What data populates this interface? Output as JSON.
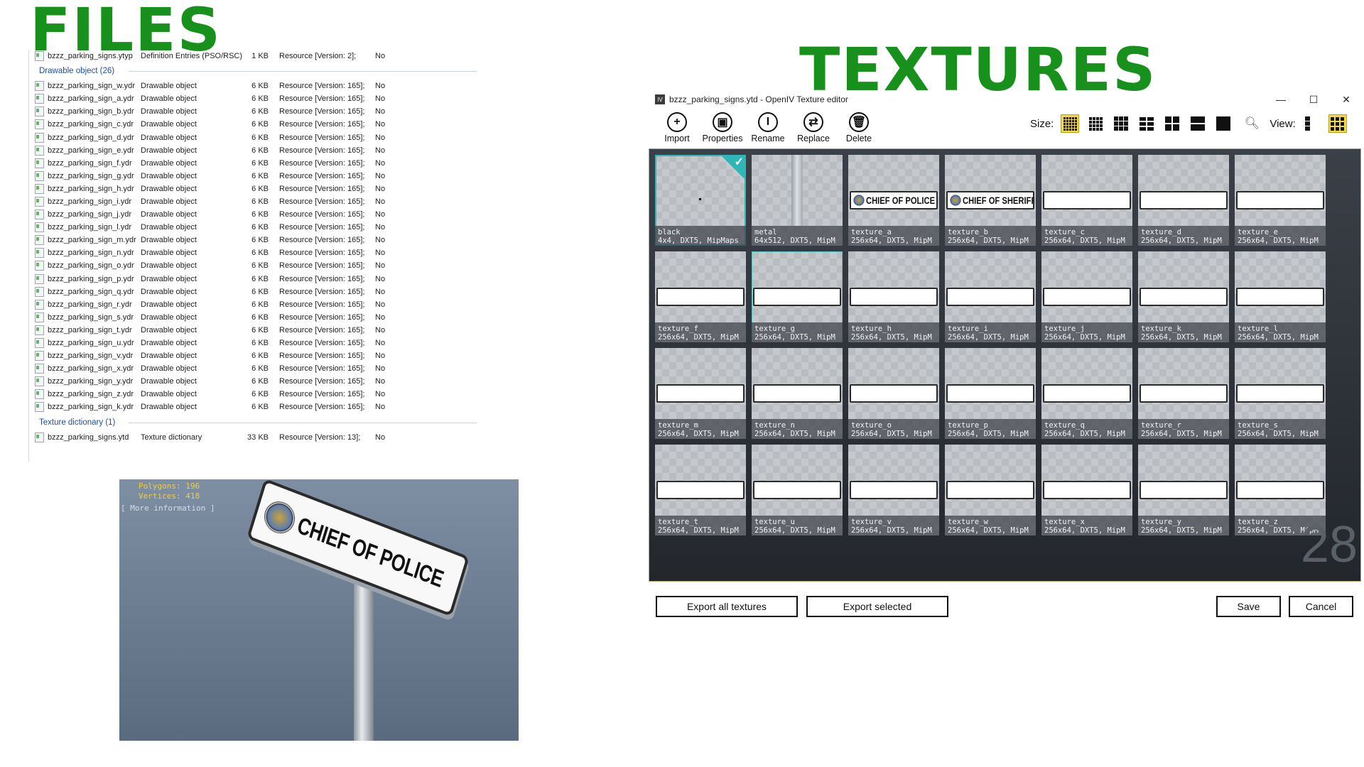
{
  "headings": {
    "files": "FILES",
    "textures": "TEXTURES"
  },
  "file_list": {
    "top_row": {
      "name": "bzzz_parking_signs.ytyp",
      "type": "Definition Entries (PSO/RSC)",
      "size": "1 KB",
      "version": "Resource [Version: 2];",
      "flag": "No"
    },
    "groups": [
      {
        "label": "Drawable object (26)",
        "rows": [
          {
            "name": "bzzz_parking_sign_w.ydr",
            "type": "Drawable object",
            "size": "6 KB",
            "version": "Resource [Version: 165];",
            "flag": "No"
          },
          {
            "name": "bzzz_parking_sign_a.ydr",
            "type": "Drawable object",
            "size": "6 KB",
            "version": "Resource [Version: 165];",
            "flag": "No"
          },
          {
            "name": "bzzz_parking_sign_b.ydr",
            "type": "Drawable object",
            "size": "6 KB",
            "version": "Resource [Version: 165];",
            "flag": "No"
          },
          {
            "name": "bzzz_parking_sign_c.ydr",
            "type": "Drawable object",
            "size": "6 KB",
            "version": "Resource [Version: 165];",
            "flag": "No"
          },
          {
            "name": "bzzz_parking_sign_d.ydr",
            "type": "Drawable object",
            "size": "6 KB",
            "version": "Resource [Version: 165];",
            "flag": "No"
          },
          {
            "name": "bzzz_parking_sign_e.ydr",
            "type": "Drawable object",
            "size": "6 KB",
            "version": "Resource [Version: 165];",
            "flag": "No"
          },
          {
            "name": "bzzz_parking_sign_f.ydr",
            "type": "Drawable object",
            "size": "6 KB",
            "version": "Resource [Version: 165];",
            "flag": "No"
          },
          {
            "name": "bzzz_parking_sign_g.ydr",
            "type": "Drawable object",
            "size": "6 KB",
            "version": "Resource [Version: 165];",
            "flag": "No"
          },
          {
            "name": "bzzz_parking_sign_h.ydr",
            "type": "Drawable object",
            "size": "6 KB",
            "version": "Resource [Version: 165];",
            "flag": "No"
          },
          {
            "name": "bzzz_parking_sign_i.ydr",
            "type": "Drawable object",
            "size": "6 KB",
            "version": "Resource [Version: 165];",
            "flag": "No"
          },
          {
            "name": "bzzz_parking_sign_j.ydr",
            "type": "Drawable object",
            "size": "6 KB",
            "version": "Resource [Version: 165];",
            "flag": "No"
          },
          {
            "name": "bzzz_parking_sign_l.ydr",
            "type": "Drawable object",
            "size": "6 KB",
            "version": "Resource [Version: 165];",
            "flag": "No"
          },
          {
            "name": "bzzz_parking_sign_m.ydr",
            "type": "Drawable object",
            "size": "6 KB",
            "version": "Resource [Version: 165];",
            "flag": "No"
          },
          {
            "name": "bzzz_parking_sign_n.ydr",
            "type": "Drawable object",
            "size": "6 KB",
            "version": "Resource [Version: 165];",
            "flag": "No"
          },
          {
            "name": "bzzz_parking_sign_o.ydr",
            "type": "Drawable object",
            "size": "6 KB",
            "version": "Resource [Version: 165];",
            "flag": "No"
          },
          {
            "name": "bzzz_parking_sign_p.ydr",
            "type": "Drawable object",
            "size": "6 KB",
            "version": "Resource [Version: 165];",
            "flag": "No"
          },
          {
            "name": "bzzz_parking_sign_q.ydr",
            "type": "Drawable object",
            "size": "6 KB",
            "version": "Resource [Version: 165];",
            "flag": "No"
          },
          {
            "name": "bzzz_parking_sign_r.ydr",
            "type": "Drawable object",
            "size": "6 KB",
            "version": "Resource [Version: 165];",
            "flag": "No"
          },
          {
            "name": "bzzz_parking_sign_s.ydr",
            "type": "Drawable object",
            "size": "6 KB",
            "version": "Resource [Version: 165];",
            "flag": "No"
          },
          {
            "name": "bzzz_parking_sign_t.ydr",
            "type": "Drawable object",
            "size": "6 KB",
            "version": "Resource [Version: 165];",
            "flag": "No"
          },
          {
            "name": "bzzz_parking_sign_u.ydr",
            "type": "Drawable object",
            "size": "6 KB",
            "version": "Resource [Version: 165];",
            "flag": "No"
          },
          {
            "name": "bzzz_parking_sign_v.ydr",
            "type": "Drawable object",
            "size": "6 KB",
            "version": "Resource [Version: 165];",
            "flag": "No"
          },
          {
            "name": "bzzz_parking_sign_x.ydr",
            "type": "Drawable object",
            "size": "6 KB",
            "version": "Resource [Version: 165];",
            "flag": "No"
          },
          {
            "name": "bzzz_parking_sign_y.ydr",
            "type": "Drawable object",
            "size": "6 KB",
            "version": "Resource [Version: 165];",
            "flag": "No"
          },
          {
            "name": "bzzz_parking_sign_z.ydr",
            "type": "Drawable object",
            "size": "6 KB",
            "version": "Resource [Version: 165];",
            "flag": "No"
          },
          {
            "name": "bzzz_parking_sign_k.ydr",
            "type": "Drawable object",
            "size": "6 KB",
            "version": "Resource [Version: 165];",
            "flag": "No"
          }
        ]
      },
      {
        "label": "Texture dictionary (1)",
        "rows": [
          {
            "name": "bzzz_parking_signs.ytd",
            "type": "Texture dictionary",
            "size": "33 KB",
            "version": "Resource [Version: 13];",
            "flag": "No"
          }
        ]
      }
    ]
  },
  "viewport": {
    "polygons": "Polygons: 196",
    "vertices": "Vertices: 418",
    "more_info": "[ More information ]",
    "sign_text": "CHIEF OF POLICE"
  },
  "texture_editor": {
    "title": "bzzz_parking_signs.ytd - OpenIV Texture editor",
    "app_icon": "IV",
    "window_buttons": {
      "minimize": "—",
      "maximize": "☐",
      "close": "✕"
    },
    "tools": [
      {
        "label": "Import",
        "glyph": "+",
        "icon": "import-icon"
      },
      {
        "label": "Properties",
        "glyph": "▣",
        "icon": "properties-icon"
      },
      {
        "label": "Rename",
        "glyph": "I",
        "icon": "rename-icon"
      },
      {
        "label": "Replace",
        "glyph": "⇄",
        "icon": "replace-icon"
      },
      {
        "label": "Delete",
        "glyph": "🗑",
        "icon": "delete-icon"
      }
    ],
    "size_label": "Size:",
    "view_label": "View:",
    "texture_count": "28",
    "textures": [
      {
        "name": "black",
        "info": "4x4, DXT5, MipMaps",
        "kind": "dot",
        "state": "selected"
      },
      {
        "name": "metal",
        "info": "64x512, DXT5, MipM",
        "kind": "metal",
        "state": ""
      },
      {
        "name": "texture_a",
        "info": "256x64, DXT5, MipM",
        "kind": "sign",
        "sign_text": "CHIEF OF POLICE",
        "state": ""
      },
      {
        "name": "texture_b",
        "info": "256x64, DXT5, MipM",
        "kind": "sign",
        "sign_text": "CHIEF OF SHERIFF",
        "state": ""
      },
      {
        "name": "texture_c",
        "info": "256x64, DXT5, MipM",
        "kind": "blank",
        "state": ""
      },
      {
        "name": "texture_d",
        "info": "256x64, DXT5, MipM",
        "kind": "blank",
        "state": ""
      },
      {
        "name": "texture_e",
        "info": "256x64, DXT5, MipM",
        "kind": "blank",
        "state": ""
      },
      {
        "name": "texture_f",
        "info": "256x64, DXT5, MipM",
        "kind": "blank",
        "state": ""
      },
      {
        "name": "texture_g",
        "info": "256x64, DXT5, MipM",
        "kind": "blank",
        "state": "hover"
      },
      {
        "name": "texture_h",
        "info": "256x64, DXT5, MipM",
        "kind": "blank",
        "state": ""
      },
      {
        "name": "texture_i",
        "info": "256x64, DXT5, MipM",
        "kind": "blank",
        "state": ""
      },
      {
        "name": "texture_j",
        "info": "256x64, DXT5, MipM",
        "kind": "blank",
        "state": ""
      },
      {
        "name": "texture_k",
        "info": "256x64, DXT5, MipM",
        "kind": "blank",
        "state": ""
      },
      {
        "name": "texture_l",
        "info": "256x64, DXT5, MipM",
        "kind": "blank",
        "state": ""
      },
      {
        "name": "texture_m",
        "info": "256x64, DXT5, MipM",
        "kind": "blank",
        "state": ""
      },
      {
        "name": "texture_n",
        "info": "256x64, DXT5, MipM",
        "kind": "blank",
        "state": ""
      },
      {
        "name": "texture_o",
        "info": "256x64, DXT5, MipM",
        "kind": "blank",
        "state": ""
      },
      {
        "name": "texture_p",
        "info": "256x64, DXT5, MipM",
        "kind": "blank",
        "state": ""
      },
      {
        "name": "texture_q",
        "info": "256x64, DXT5, MipM",
        "kind": "blank",
        "state": ""
      },
      {
        "name": "texture_r",
        "info": "256x64, DXT5, MipM",
        "kind": "blank",
        "state": ""
      },
      {
        "name": "texture_s",
        "info": "256x64, DXT5, MipM",
        "kind": "blank",
        "state": ""
      },
      {
        "name": "texture_t",
        "info": "256x64, DXT5, MipM",
        "kind": "blank",
        "state": ""
      },
      {
        "name": "texture_u",
        "info": "256x64, DXT5, MipM",
        "kind": "blank",
        "state": ""
      },
      {
        "name": "texture_v",
        "info": "256x64, DXT5, MipM",
        "kind": "blank",
        "state": ""
      },
      {
        "name": "texture_w",
        "info": "256x64, DXT5, MipM",
        "kind": "blank",
        "state": ""
      },
      {
        "name": "texture_x",
        "info": "256x64, DXT5, MipM",
        "kind": "blank",
        "state": ""
      },
      {
        "name": "texture_y",
        "info": "256x64, DXT5, MipM",
        "kind": "blank",
        "state": ""
      },
      {
        "name": "texture_z",
        "info": "256x64, DXT5, MipM",
        "kind": "blank",
        "state": ""
      }
    ],
    "buttons": {
      "export_all": "Export all textures",
      "export_selected": "Export selected",
      "save": "Save",
      "cancel": "Cancel"
    }
  },
  "colors": {
    "heading_green": "#17911c",
    "selection_teal": "#2fb7b7",
    "size_highlight": "#f2d94a",
    "group_blue": "#1e4fa8",
    "stats_yellow": "#f0d040"
  }
}
